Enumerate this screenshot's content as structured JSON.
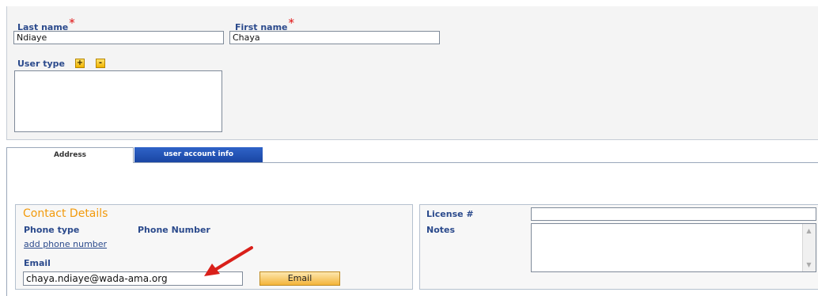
{
  "person": {
    "last_name_label": "Last name",
    "last_name_value": "Ndiaye",
    "first_name_label": "First name",
    "first_name_value": "Chaya",
    "required_mark": "*",
    "user_type_label": "User type",
    "add_label": "+",
    "remove_label": "-"
  },
  "tabs": [
    {
      "label": "Address",
      "active": true
    },
    {
      "label": "user account info",
      "active": false
    }
  ],
  "contact": {
    "title": "Contact Details",
    "phone_type_header": "Phone type",
    "phone_number_header": "Phone Number",
    "add_phone_link": "add phone number",
    "email_label": "Email",
    "email_value": "chaya.ndiaye@wada-ama.org",
    "email_button": "Email"
  },
  "extra": {
    "license_label": "License #",
    "license_value": "",
    "notes_label": "Notes",
    "notes_value": ""
  },
  "colors": {
    "label_blue": "#2b4a8c",
    "required_red": "#e01010",
    "section_orange": "#f29a0c",
    "tab_blue": "#1a46a3",
    "arrow_red": "#d9201a"
  }
}
